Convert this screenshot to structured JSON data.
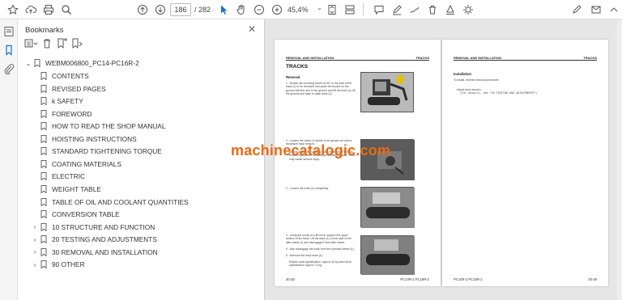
{
  "toolbar": {
    "page_current": "186",
    "page_total": "/ 282",
    "zoom": "45,4%"
  },
  "bookmarks_panel": {
    "title": "Bookmarks",
    "root": "WEBM006800_PC14-PC16R-2",
    "items": [
      {
        "label": "CONTENTS",
        "expandable": false
      },
      {
        "label": "REVISED PAGES",
        "expandable": false
      },
      {
        "label": "k SAFETY",
        "expandable": false
      },
      {
        "label": "FOREWORD",
        "expandable": false
      },
      {
        "label": "HOW TO READ THE SHOP MANUAL",
        "expandable": false
      },
      {
        "label": "HOISTING INSTRUCTIONS",
        "expandable": false
      },
      {
        "label": "STANDARD TIGHTENING TORQUE",
        "expandable": false
      },
      {
        "label": "COATING MATERIALS",
        "expandable": false
      },
      {
        "label": "ELECTRIC",
        "expandable": false
      },
      {
        "label": "WEIGHT TABLE",
        "expandable": false
      },
      {
        "label": "TABLE OF OIL AND COOLANT QUANTITIES",
        "expandable": false
      },
      {
        "label": "CONVERSION TABLE",
        "expandable": false
      },
      {
        "label": "10 STRUCTURE AND FUNCTION",
        "expandable": true
      },
      {
        "label": "20 TESTING AND ADJUSTMENTS",
        "expandable": true
      },
      {
        "label": "30 REMOVAL AND INSTALLATION",
        "expandable": true
      },
      {
        "label": "90 OTHER",
        "expandable": true
      }
    ]
  },
  "left_page": {
    "header_left": "REMOVAL AND INSTALLATION",
    "header_right": "TRACKS",
    "title": "TRACKS",
    "subtitle": "Removal",
    "step1": "1 - Rotate the revolving frame by 90° to the side of the track (1) to be removed and place the bucket on the ground with the arm to the ground and lift the track (1) off the ground and raise to raise track (1).",
    "step2": "2 - Loosen the valve (1) slowly to let grease out and to neutralize track tension.",
    "warning": "Do not loosen the valve by more than turn. The track tensioning cylinder contains pressurised grease, which may cause serious injury.",
    "step3": "3 - Loosen the track (1) completely.",
    "step4": "4 - Using the hooks of a lift truck, support the upper section of the track. Lift the track (1) on the side of the idler wheel (1) and disengage it from idler wheel.",
    "step5": "5 - Also disengage the track from the sprocket wheel (1).",
    "step6": "6 - Remove the track shoe (1).",
    "spec": "Rubber shoe specification: approx 40 kg steel shoe specification: approx 70 kg",
    "footer_left": "30-28",
    "footer_right": "PC14R-2 PC16R-2"
  },
  "right_page": {
    "header_left": "REMOVAL AND INSTALLATION",
    "header_right": "TRACKS",
    "subtitle": "Installation",
    "line1": "To install, reverse removal procedure.",
    "line2": "Adjust track tension.",
    "line3": "(For details, see \"20 TESTING AND ADJUSTMENTS\")",
    "footer_left": "PC14R-2 PC16R-2",
    "footer_right": "30-29"
  },
  "watermark": "machinecatalogic.com",
  "colors": {
    "watermark": "#e86a12",
    "accent_blue": "#1a73c7"
  }
}
